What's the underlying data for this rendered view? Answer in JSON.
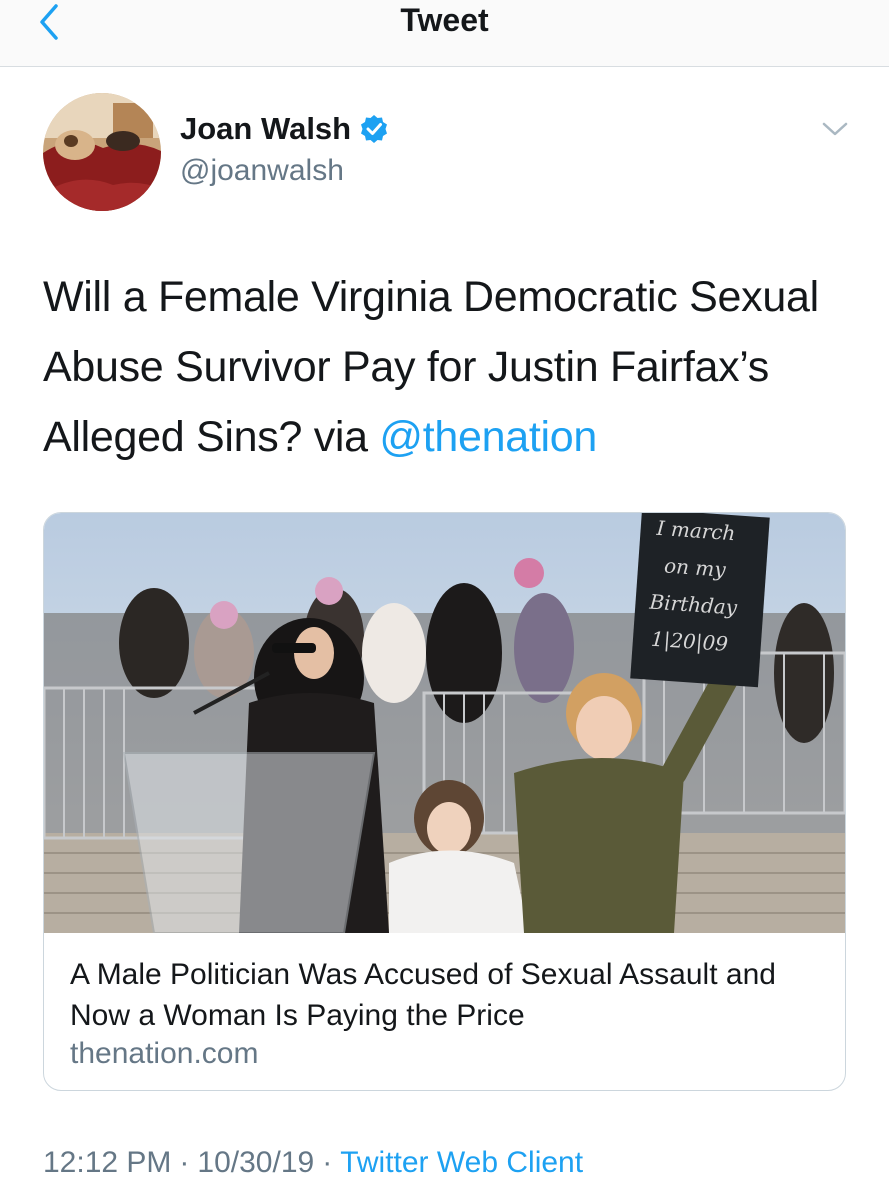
{
  "nav": {
    "title": "Tweet"
  },
  "tweet": {
    "author_name": "Joan Walsh",
    "author_handle": "@joanwalsh",
    "text_before_mention": "Will a Female Virginia Democratic Sexual Abuse Survivor Pay for Justin Fairfax’s Alleged Sins? via ",
    "mention": "@thenation",
    "time": "12:12 PM",
    "separator": "·",
    "date": "10/30/19",
    "source": "Twitter Web Client"
  },
  "card": {
    "title": "A Male Politician Was Accused of Sexual Assault and Now a Woman Is Paying the Price",
    "domain": "thenation.com",
    "sign_lines": [
      "I march",
      "on my",
      "Birthday",
      "1|20|09"
    ]
  },
  "icons": {
    "back": "chevron-left-icon",
    "verified": "verified-badge-icon",
    "menu": "chevron-down-icon"
  },
  "colors": {
    "accent": "#1da1f2",
    "secondary_text": "#657786",
    "primary_text": "#14171a",
    "border": "#ccd6dd"
  }
}
